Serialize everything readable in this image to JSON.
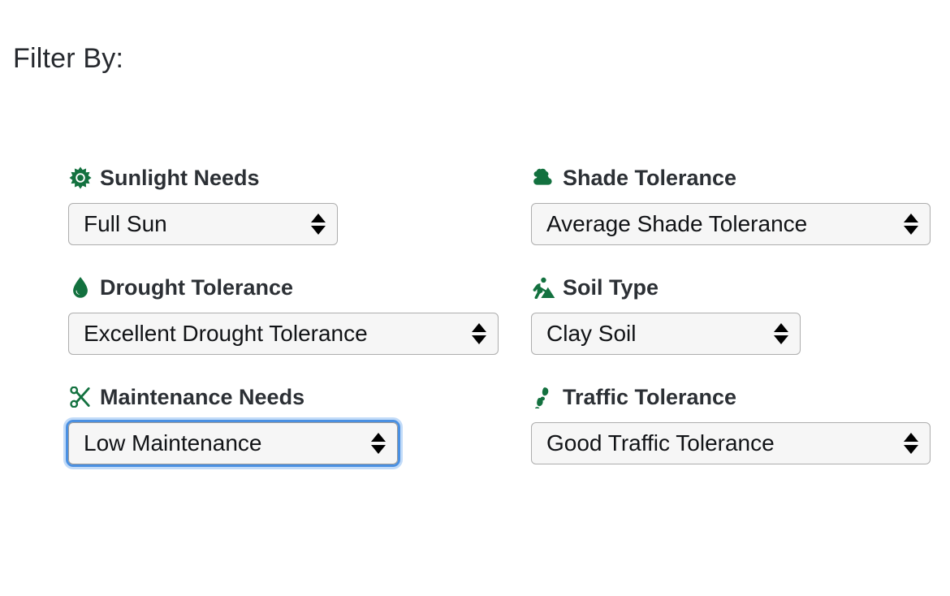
{
  "page": {
    "title": "Filter By:",
    "background": "#ffffff",
    "accent_green": "#13713f",
    "label_color": "#2c3035",
    "focus_ring_color": "#4a90e2",
    "select_background": "#f6f6f6",
    "select_border": "#adadad"
  },
  "filters": [
    {
      "id": "sunlight-needs",
      "label": "Sunlight Needs",
      "icon": "sun-icon",
      "value": "Full Sun",
      "focused": false
    },
    {
      "id": "shade-tolerance",
      "label": "Shade Tolerance",
      "icon": "clouds-icon",
      "value": "Average Shade Tolerance",
      "focused": false
    },
    {
      "id": "drought-tolerance",
      "label": "Drought Tolerance",
      "icon": "water-drop-icon",
      "value": "Excellent Drought Tolerance",
      "focused": false
    },
    {
      "id": "soil-type",
      "label": "Soil Type",
      "icon": "digging-worker-icon",
      "value": "Clay Soil",
      "focused": false
    },
    {
      "id": "maintenance-needs",
      "label": "Maintenance Needs",
      "icon": "scissors-icon",
      "value": "Low Maintenance",
      "focused": true
    },
    {
      "id": "traffic-tolerance",
      "label": "Traffic Tolerance",
      "icon": "footprints-icon",
      "value": "Good Traffic Tolerance",
      "focused": false
    }
  ]
}
